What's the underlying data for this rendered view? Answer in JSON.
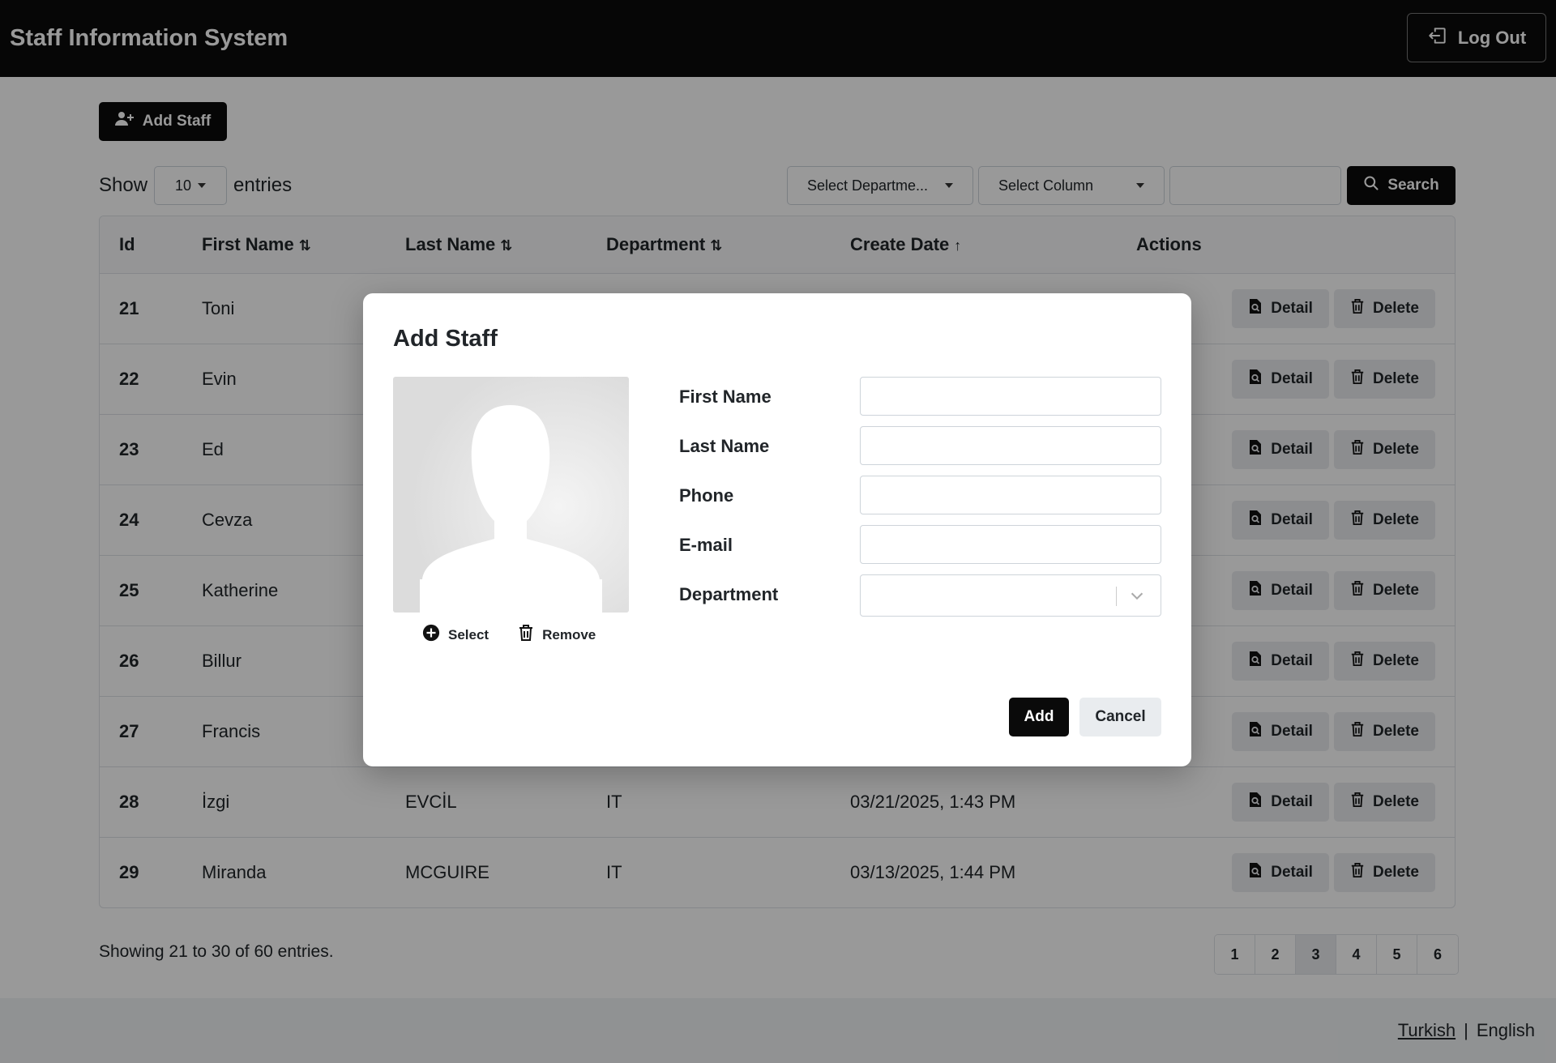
{
  "header": {
    "title": "Staff Information System",
    "logout_label": "Log Out"
  },
  "toolbar": {
    "add_staff_label": "Add Staff",
    "show_label": "Show",
    "entries_value": "10",
    "entries_label": "entries",
    "department_select": "Select Departme...",
    "column_select": "Select Column",
    "search_value": "",
    "search_label": "Search"
  },
  "table": {
    "columns": [
      "Id",
      "First Name",
      "Last Name",
      "Department",
      "Create Date",
      "Actions"
    ],
    "sort_icons": {
      "first_name": "⇅",
      "last_name": "⇅",
      "department": "⇅",
      "create_date": "↑"
    },
    "detail_label": "Detail",
    "delete_label": "Delete",
    "rows": [
      {
        "id": "21",
        "first_name": "Toni",
        "last_name": "",
        "department": "",
        "create_date": ""
      },
      {
        "id": "22",
        "first_name": "Evin",
        "last_name": "",
        "department": "",
        "create_date": ""
      },
      {
        "id": "23",
        "first_name": "Ed",
        "last_name": "",
        "department": "",
        "create_date": ""
      },
      {
        "id": "24",
        "first_name": "Cevza",
        "last_name": "",
        "department": "",
        "create_date": ""
      },
      {
        "id": "25",
        "first_name": "Katherine",
        "last_name": "",
        "department": "",
        "create_date": ""
      },
      {
        "id": "26",
        "first_name": "Billur",
        "last_name": "",
        "department": "",
        "create_date": ""
      },
      {
        "id": "27",
        "first_name": "Francis",
        "last_name": "",
        "department": "",
        "create_date": ""
      },
      {
        "id": "28",
        "first_name": "İzgi",
        "last_name": "EVCİL",
        "department": "IT",
        "create_date": "03/21/2025, 1:43 PM"
      },
      {
        "id": "29",
        "first_name": "Miranda",
        "last_name": "MCGUIRE",
        "department": "IT",
        "create_date": "03/13/2025, 1:44 PM"
      }
    ]
  },
  "pagination": {
    "summary": "Showing 21 to 30 of 60 entries.",
    "pages": [
      "1",
      "2",
      "3",
      "4",
      "5",
      "6"
    ],
    "active_page": "3"
  },
  "footer": {
    "lang_turkish": "Turkish",
    "separator": "|",
    "lang_english": "English"
  },
  "modal": {
    "title": "Add Staff",
    "select_photo_label": "Select",
    "remove_photo_label": "Remove",
    "fields": {
      "first_name": {
        "label": "First Name",
        "value": ""
      },
      "last_name": {
        "label": "Last Name",
        "value": ""
      },
      "phone": {
        "label": "Phone",
        "value": ""
      },
      "email": {
        "label": "E-mail",
        "value": ""
      },
      "department": {
        "label": "Department",
        "value": ""
      }
    },
    "add_label": "Add",
    "cancel_label": "Cancel"
  },
  "colors": {
    "header_bg": "#0a0a0a",
    "primary_button": "#0a0a0a",
    "secondary_button": "#e9ecef",
    "overlay": "rgba(0,0,0,0.40)"
  }
}
